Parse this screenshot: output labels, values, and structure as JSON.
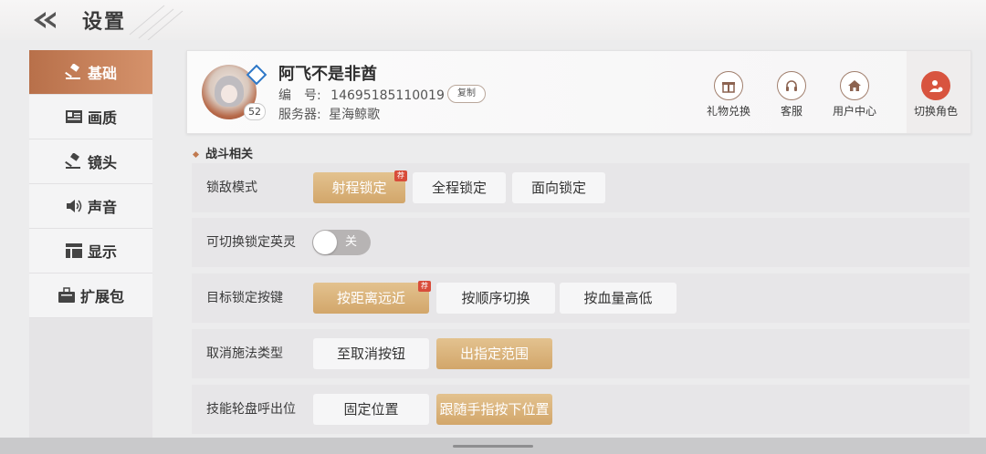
{
  "header": {
    "title": "设置"
  },
  "sidebar": {
    "items": [
      {
        "label": "基础",
        "icon": "gavel-icon",
        "active": true
      },
      {
        "label": "画质",
        "icon": "image-icon",
        "active": false
      },
      {
        "label": "镜头",
        "icon": "camera-icon",
        "active": false
      },
      {
        "label": "声音",
        "icon": "speaker-icon",
        "active": false
      },
      {
        "label": "显示",
        "icon": "layout-icon",
        "active": false
      },
      {
        "label": "扩展包",
        "icon": "briefcase-icon",
        "active": false
      }
    ]
  },
  "profile": {
    "name": "阿飞不是非酋",
    "id_label": "编　号:",
    "id_value": "14695185110019",
    "copy_label": "复制",
    "server_label": "服务器:",
    "server_value": "星海鲸歌",
    "level": "52",
    "actions": [
      {
        "label": "礼物兑换",
        "icon": "gift-icon"
      },
      {
        "label": "客服",
        "icon": "headset-icon"
      },
      {
        "label": "用户中心",
        "icon": "home-icon"
      },
      {
        "label": "切换角色",
        "icon": "user-switch-icon"
      }
    ]
  },
  "section": {
    "title": "战斗相关"
  },
  "settings": [
    {
      "label": "锁敌模式",
      "options": [
        "射程锁定",
        "全程锁定",
        "面向锁定"
      ],
      "selected": 0,
      "recommended_badge": "荐"
    },
    {
      "label": "可切换锁定英灵",
      "toggle_label": "关",
      "toggle_on": false
    },
    {
      "label": "目标锁定按键",
      "options": [
        "按距离远近",
        "按顺序切换",
        "按血量高低"
      ],
      "selected": 0,
      "recommended_badge": "荐"
    },
    {
      "label": "取消施法类型",
      "options": [
        "至取消按钮",
        "出指定范围"
      ],
      "selected": 1
    },
    {
      "label": "技能轮盘呼出位",
      "options": [
        "固定位置",
        "跟随手指按下位置"
      ],
      "selected": 1
    }
  ],
  "colors": {
    "accent": "#c98058",
    "selected_option": "#d8b079",
    "badge": "#d84c3a"
  }
}
